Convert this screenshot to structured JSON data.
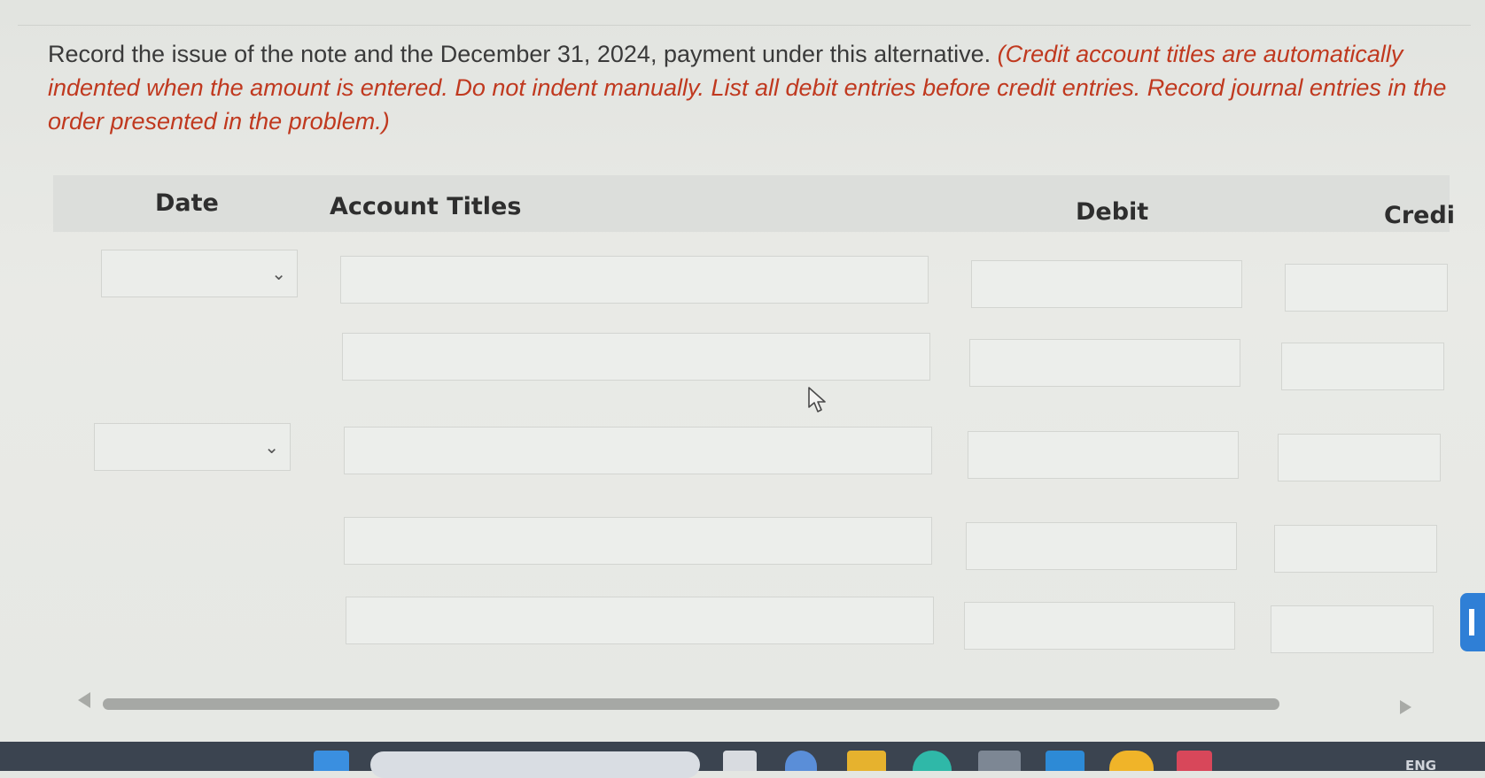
{
  "instructions": {
    "main": "Record the issue of the note and the December 31, 2024, payment under this alternative. ",
    "note": "(Credit account titles are automatically indented when the amount is entered. Do not indent manually. List all debit entries before credit entries. Record journal entries in the order presented in the problem.)"
  },
  "table": {
    "headers": {
      "date": "Date",
      "account_titles": "Account Titles",
      "debit": "Debit",
      "credit": "Credi"
    },
    "date_selects": [
      {
        "selected": ""
      },
      {
        "selected": ""
      }
    ],
    "rows": [
      {
        "account": "",
        "debit": "",
        "credit": ""
      },
      {
        "account": "",
        "debit": "",
        "credit": ""
      },
      {
        "account": "",
        "debit": "",
        "credit": ""
      },
      {
        "account": "",
        "debit": "",
        "credit": ""
      },
      {
        "account": "",
        "debit": "",
        "credit": ""
      }
    ]
  },
  "icons": {
    "chevron": "chevron-down-icon",
    "cursor": "mouse-pointer-icon",
    "scroll_left": "scroll-left-arrow-icon",
    "scroll_right": "scroll-right-arrow-icon"
  },
  "taskbar": {
    "sys_tray_text": "ENG"
  },
  "colors": {
    "instruction_note": "#c0391f",
    "side_tab": "#2f7fd6",
    "taskbar": "#3b4450"
  }
}
